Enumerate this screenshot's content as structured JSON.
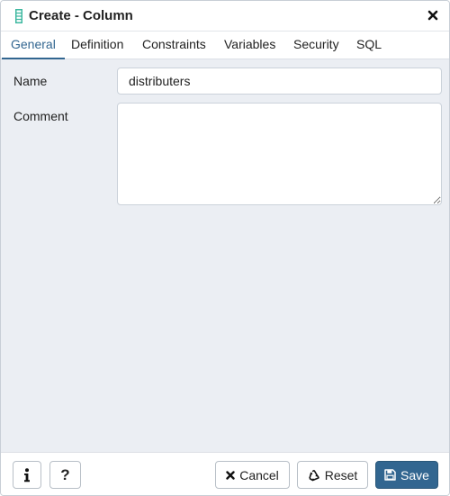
{
  "dialog": {
    "title": "Create - Column",
    "icons": {
      "title": "column-icon",
      "close": "close-icon"
    }
  },
  "tabs": [
    {
      "label": "General",
      "active": true
    },
    {
      "label": "Definition",
      "active": false
    },
    {
      "label": "Constraints",
      "active": false
    },
    {
      "label": "Variables",
      "active": false
    },
    {
      "label": "Security",
      "active": false
    },
    {
      "label": "SQL",
      "active": false
    }
  ],
  "form": {
    "name_label": "Name",
    "name_value": "distributers",
    "comment_label": "Comment",
    "comment_value": ""
  },
  "footer": {
    "info_icon": "info-icon",
    "help_label": "?",
    "cancel_label": "Cancel",
    "reset_label": "Reset",
    "save_label": "Save"
  },
  "colors": {
    "accent": "#326690",
    "content_background": "#ebeef3",
    "column_icon": "#3eb8a0"
  }
}
